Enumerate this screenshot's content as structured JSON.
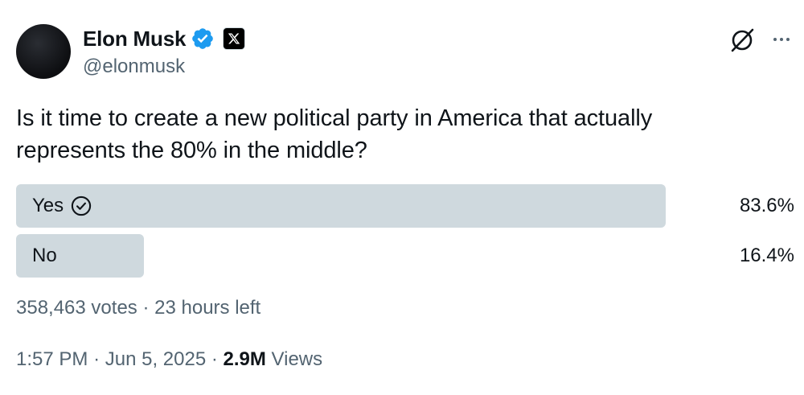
{
  "author": {
    "display_name": "Elon Musk",
    "handle": "@elonmusk",
    "verified_icon": "verified-badge-icon",
    "affiliate_icon": "x-logo-icon",
    "badge_color": "#1d9bf0"
  },
  "header_actions": {
    "grok_icon": "grok-icon",
    "more_icon": "more-options-icon"
  },
  "tweet": {
    "text": "Is it time to create a new political party in America that actually\nrepresents the 80% in the middle?"
  },
  "poll": {
    "options": [
      {
        "label": "Yes",
        "percent_text": "83.6%",
        "fraction": 0.836,
        "selected": true
      },
      {
        "label": "No",
        "percent_text": "16.4%",
        "fraction": 0.164,
        "selected": false
      }
    ],
    "votes": "358,463 votes",
    "time_left": "23 hours left",
    "bar_color": "#cfd9de"
  },
  "meta": {
    "time": "1:57 PM",
    "date": "Jun 5, 2025",
    "views_count": "2.9M",
    "views_label": "Views"
  }
}
